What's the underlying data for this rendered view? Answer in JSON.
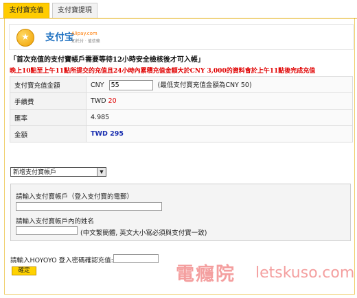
{
  "tabs": [
    {
      "label": "支付寶充值",
      "active": true
    },
    {
      "label": "支付寶提現",
      "active": false
    }
  ],
  "logo": {
    "brand": "支付宝",
    "domain": "Alipay.com",
    "tagline": "知托付 · 值信赖"
  },
  "notices": {
    "line1": "「首次充值的支付寶帳戶需要等待12小時安全檢核後才可入帳」",
    "line2": "晚上10點至上午11點所提交的充值且24小時內累積充值金額大於CNY 3,000的資料會於上午11點後完成充值"
  },
  "info_table": {
    "amount_label": "支付寶充值金額",
    "amount_currency": "CNY",
    "amount_value": "55",
    "amount_hint": "(最低支付寶充值金額為CNY 50)",
    "fee_label": "手續費",
    "fee_currency": "TWD",
    "fee_value": "20",
    "rate_label": "匯率",
    "rate_value": "4.985",
    "total_label": "金額",
    "total_value": "TWD 295"
  },
  "account_select": {
    "selected": "新增支付寶帳戶"
  },
  "account_form": {
    "email_label": "請輸入支付寶帳戶（登入支付寶的電郵）",
    "email_value": "",
    "name_label": "請輸入支付寶帳戶內的姓名",
    "name_value": "",
    "name_hint": "(中文繁簡體, 英文大小寫必須與支付寶一致)"
  },
  "password": {
    "label": "請輸入HOYOYO 登入密碼確認充值:",
    "value": ""
  },
  "confirm_label": "確定",
  "watermark": {
    "cn": "電癮院",
    "en": "letskuso.com"
  },
  "colors": {
    "tab_active": "#ffcc00",
    "notice_red": "#e00000",
    "total_blue": "#1a2fb0",
    "confirm_button": "#ffd200"
  }
}
